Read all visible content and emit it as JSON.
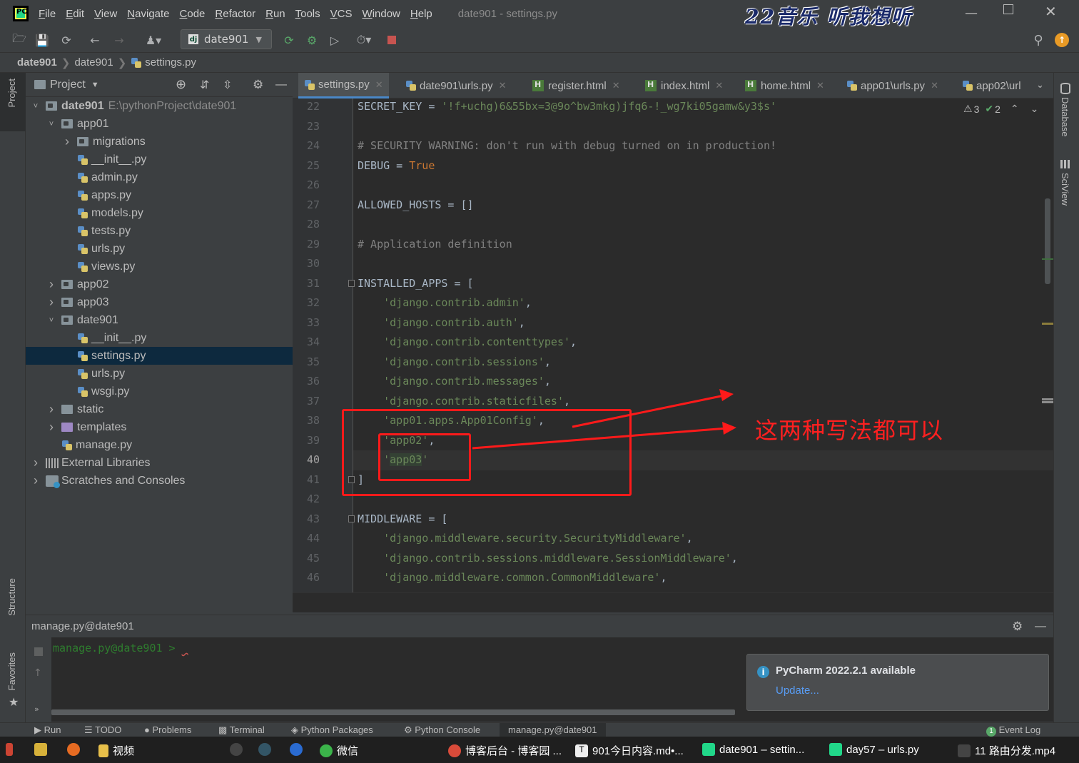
{
  "window": {
    "title": "date901 - settings.py",
    "watermark": "22音乐 听我想听",
    "menu": [
      "File",
      "Edit",
      "View",
      "Navigate",
      "Code",
      "Refactor",
      "Run",
      "Tools",
      "VCS",
      "Window",
      "Help"
    ]
  },
  "toolbar": {
    "run_config": "date901"
  },
  "breadcrumb": [
    "date901",
    "date901",
    "settings.py"
  ],
  "project": {
    "header": "Project",
    "tree": [
      {
        "label": "date901",
        "note": "E:\\pythonProject\\date901",
        "depth": 0,
        "type": "folder",
        "open": true,
        "bold": true
      },
      {
        "label": "app01",
        "depth": 1,
        "type": "folder",
        "open": true
      },
      {
        "label": "migrations",
        "depth": 2,
        "type": "folder",
        "open": false
      },
      {
        "label": "__init__.py",
        "depth": 2,
        "type": "py"
      },
      {
        "label": "admin.py",
        "depth": 2,
        "type": "py"
      },
      {
        "label": "apps.py",
        "depth": 2,
        "type": "py"
      },
      {
        "label": "models.py",
        "depth": 2,
        "type": "py"
      },
      {
        "label": "tests.py",
        "depth": 2,
        "type": "py"
      },
      {
        "label": "urls.py",
        "depth": 2,
        "type": "py"
      },
      {
        "label": "views.py",
        "depth": 2,
        "type": "py"
      },
      {
        "label": "app02",
        "depth": 1,
        "type": "folder",
        "open": false
      },
      {
        "label": "app03",
        "depth": 1,
        "type": "folder",
        "open": false
      },
      {
        "label": "date901",
        "depth": 1,
        "type": "folder",
        "open": true
      },
      {
        "label": "__init__.py",
        "depth": 2,
        "type": "py"
      },
      {
        "label": "settings.py",
        "depth": 2,
        "type": "py",
        "selected": true
      },
      {
        "label": "urls.py",
        "depth": 2,
        "type": "py"
      },
      {
        "label": "wsgi.py",
        "depth": 2,
        "type": "py"
      },
      {
        "label": "static",
        "depth": 1,
        "type": "plainfolder",
        "open": false
      },
      {
        "label": "templates",
        "depth": 1,
        "type": "purplefolder",
        "open": false
      },
      {
        "label": "manage.py",
        "depth": 1,
        "type": "py"
      },
      {
        "label": "External Libraries",
        "depth": 0,
        "type": "lib",
        "open": false
      },
      {
        "label": "Scratches and Consoles",
        "depth": 0,
        "type": "scratch",
        "open": false
      }
    ]
  },
  "tabs": [
    {
      "label": "settings.py",
      "type": "py",
      "active": true
    },
    {
      "label": "date901\\urls.py",
      "type": "py"
    },
    {
      "label": "register.html",
      "type": "html"
    },
    {
      "label": "index.html",
      "type": "html"
    },
    {
      "label": "home.html",
      "type": "html"
    },
    {
      "label": "app01\\urls.py",
      "type": "py"
    },
    {
      "label": "app02\\url",
      "type": "py"
    }
  ],
  "inspections": {
    "warnings": "3",
    "ok": "2"
  },
  "code": [
    {
      "n": "22",
      "t": "SECRET_KEY = '!f+uchg)6&55bx=3@9o^bw3mkg)jfq6-!_wg7ki05gamw&y3$s'"
    },
    {
      "n": "23",
      "t": ""
    },
    {
      "n": "24",
      "t": "# SECURITY WARNING: don't run with debug turned on in production!"
    },
    {
      "n": "25",
      "t": "DEBUG = True"
    },
    {
      "n": "26",
      "t": ""
    },
    {
      "n": "27",
      "t": "ALLOWED_HOSTS = []"
    },
    {
      "n": "28",
      "t": ""
    },
    {
      "n": "29",
      "t": "# Application definition"
    },
    {
      "n": "30",
      "t": ""
    },
    {
      "n": "31",
      "t": "INSTALLED_APPS = ["
    },
    {
      "n": "32",
      "t": "    'django.contrib.admin',"
    },
    {
      "n": "33",
      "t": "    'django.contrib.auth',"
    },
    {
      "n": "34",
      "t": "    'django.contrib.contenttypes',"
    },
    {
      "n": "35",
      "t": "    'django.contrib.sessions',"
    },
    {
      "n": "36",
      "t": "    'django.contrib.messages',"
    },
    {
      "n": "37",
      "t": "    'django.contrib.staticfiles',"
    },
    {
      "n": "38",
      "t": "    'app01.apps.App01Config',"
    },
    {
      "n": "39",
      "t": "    'app02',"
    },
    {
      "n": "40",
      "t": "    'app03'"
    },
    {
      "n": "41",
      "t": "]"
    },
    {
      "n": "42",
      "t": ""
    },
    {
      "n": "43",
      "t": "MIDDLEWARE = ["
    },
    {
      "n": "44",
      "t": "    'django.middleware.security.SecurityMiddleware',"
    },
    {
      "n": "45",
      "t": "    'django.contrib.sessions.middleware.SessionMiddleware',"
    },
    {
      "n": "46",
      "t": "    'django.middleware.common.CommonMiddleware',"
    }
  ],
  "annotation": "这两种写法都可以",
  "console": {
    "title": "manage.py@date901",
    "prompt": "manage.py@date901 > "
  },
  "notification": {
    "title": "PyCharm 2022.2.1 available",
    "link": "Update..."
  },
  "side_left": {
    "project": "Project",
    "structure": "Structure",
    "favorites": "Favorites"
  },
  "side_right": {
    "database": "Database",
    "sciview": "SciView"
  },
  "tool_windows": [
    "Run",
    "TODO",
    "Problems",
    "Terminal",
    "Python Packages",
    "Python Console",
    "manage.py@date901"
  ],
  "event_log": "Event Log",
  "taskbar": [
    "视频",
    "微信",
    "博客后台 - 博客园 ...",
    "901今日内容.md•...",
    "date901 – settin...",
    "day57 – urls.py",
    "11 路由分发.mp4"
  ]
}
